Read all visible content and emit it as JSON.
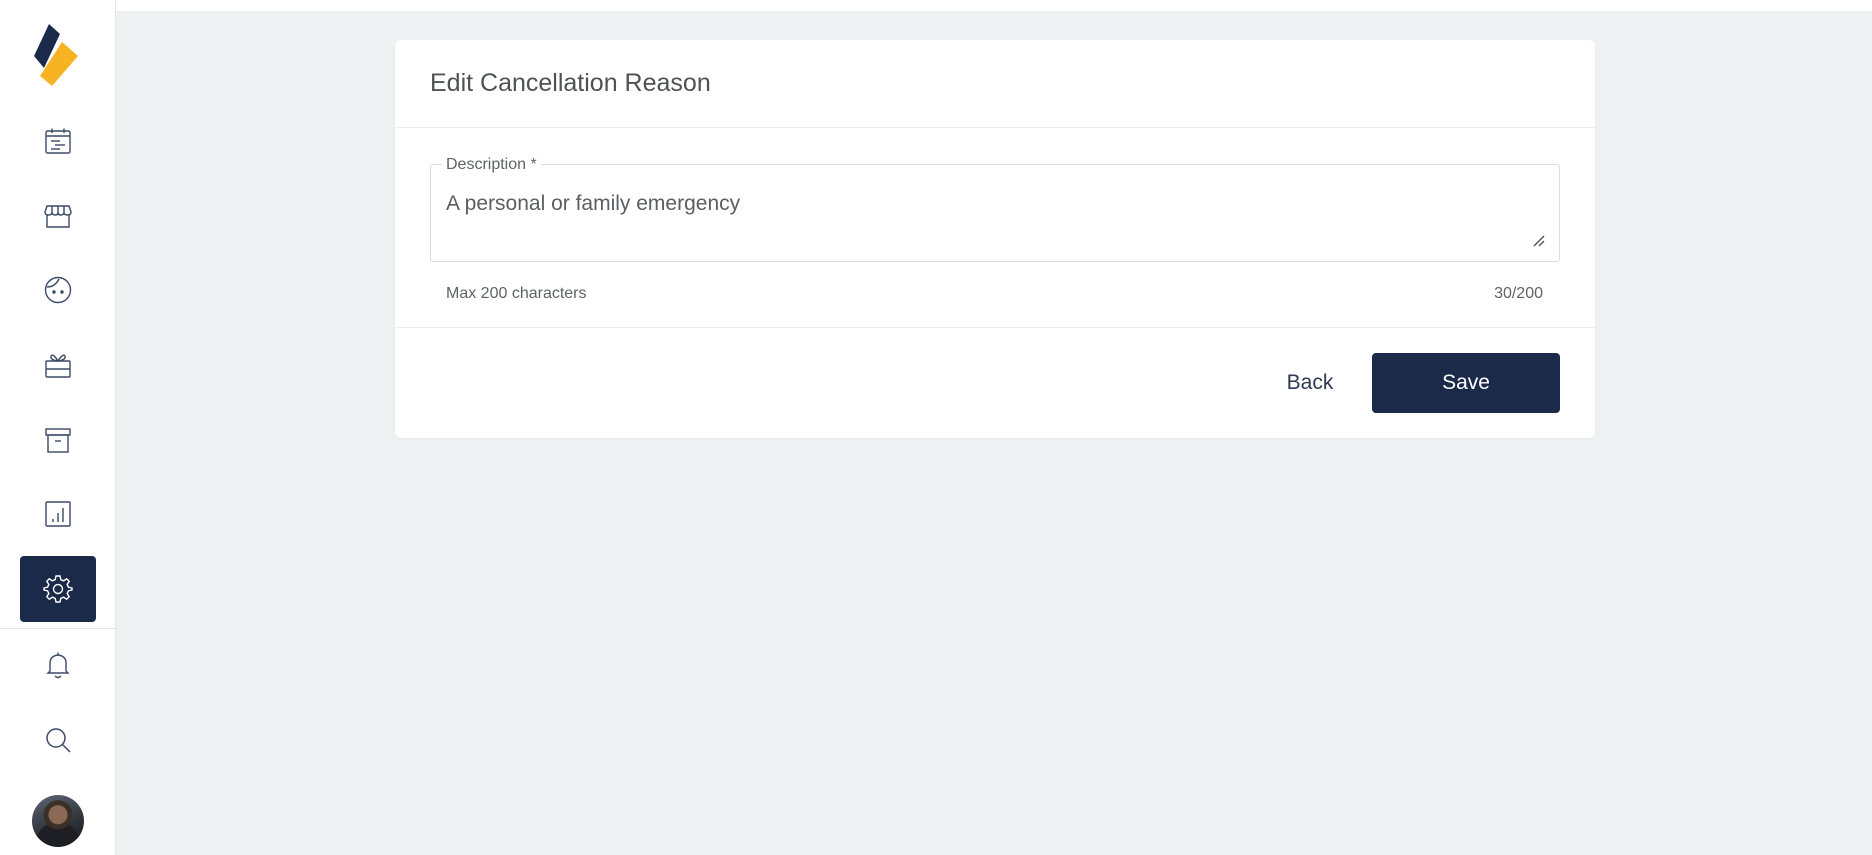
{
  "colors": {
    "primary": "#1c2a4a",
    "accent": "#f8b323",
    "background": "#eef1f2"
  },
  "sidebar": {
    "items": [
      {
        "name": "calendar-list-icon",
        "active": false
      },
      {
        "name": "storefront-icon",
        "active": false
      },
      {
        "name": "face-icon",
        "active": false
      },
      {
        "name": "gift-icon",
        "active": false
      },
      {
        "name": "archive-icon",
        "active": false
      },
      {
        "name": "bar-chart-icon",
        "active": false
      },
      {
        "name": "gear-icon",
        "active": true
      },
      {
        "name": "bell-icon",
        "active": false
      },
      {
        "name": "search-icon",
        "active": false
      }
    ]
  },
  "card": {
    "title": "Edit Cancellation Reason",
    "description_label": "Description *",
    "description_value": "A personal or family emergency",
    "helper_text": "Max 200 characters",
    "char_counter": "30/200",
    "back_label": "Back",
    "save_label": "Save"
  }
}
